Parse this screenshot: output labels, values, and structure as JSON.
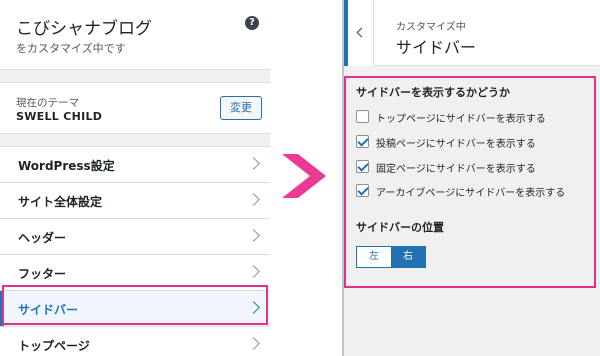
{
  "left": {
    "site_title": "こびシャナブログ",
    "site_subtitle": "をカスタマイズ中です",
    "help_icon": "?",
    "theme_label": "現在のテーマ",
    "theme_name": "SWELL CHILD",
    "change_button": "変更",
    "menu": [
      {
        "label": "WordPress設定"
      },
      {
        "label": "サイト全体設定"
      },
      {
        "label": "ヘッダー"
      },
      {
        "label": "フッター"
      },
      {
        "label": "サイドバー",
        "active": true
      },
      {
        "label": "トップページ"
      }
    ]
  },
  "right": {
    "header_sub": "カスタマイズ中",
    "header_title": "サイドバー",
    "section_title": "サイドバーを表示するかどうか",
    "options": [
      {
        "label": "トップページにサイドバーを表示する",
        "checked": false
      },
      {
        "label": "投稿ページにサイドバーを表示する",
        "checked": true
      },
      {
        "label": "固定ページにサイドバーを表示する",
        "checked": true
      },
      {
        "label": "アーカイブページにサイドバーを表示する",
        "checked": true
      }
    ],
    "position_title": "サイドバーの位置",
    "position_options": [
      "左",
      "右"
    ],
    "position_selected": "右"
  },
  "colors": {
    "accent": "#2271b1",
    "highlight": "#e0328b",
    "arrow": "#ec3a94"
  }
}
